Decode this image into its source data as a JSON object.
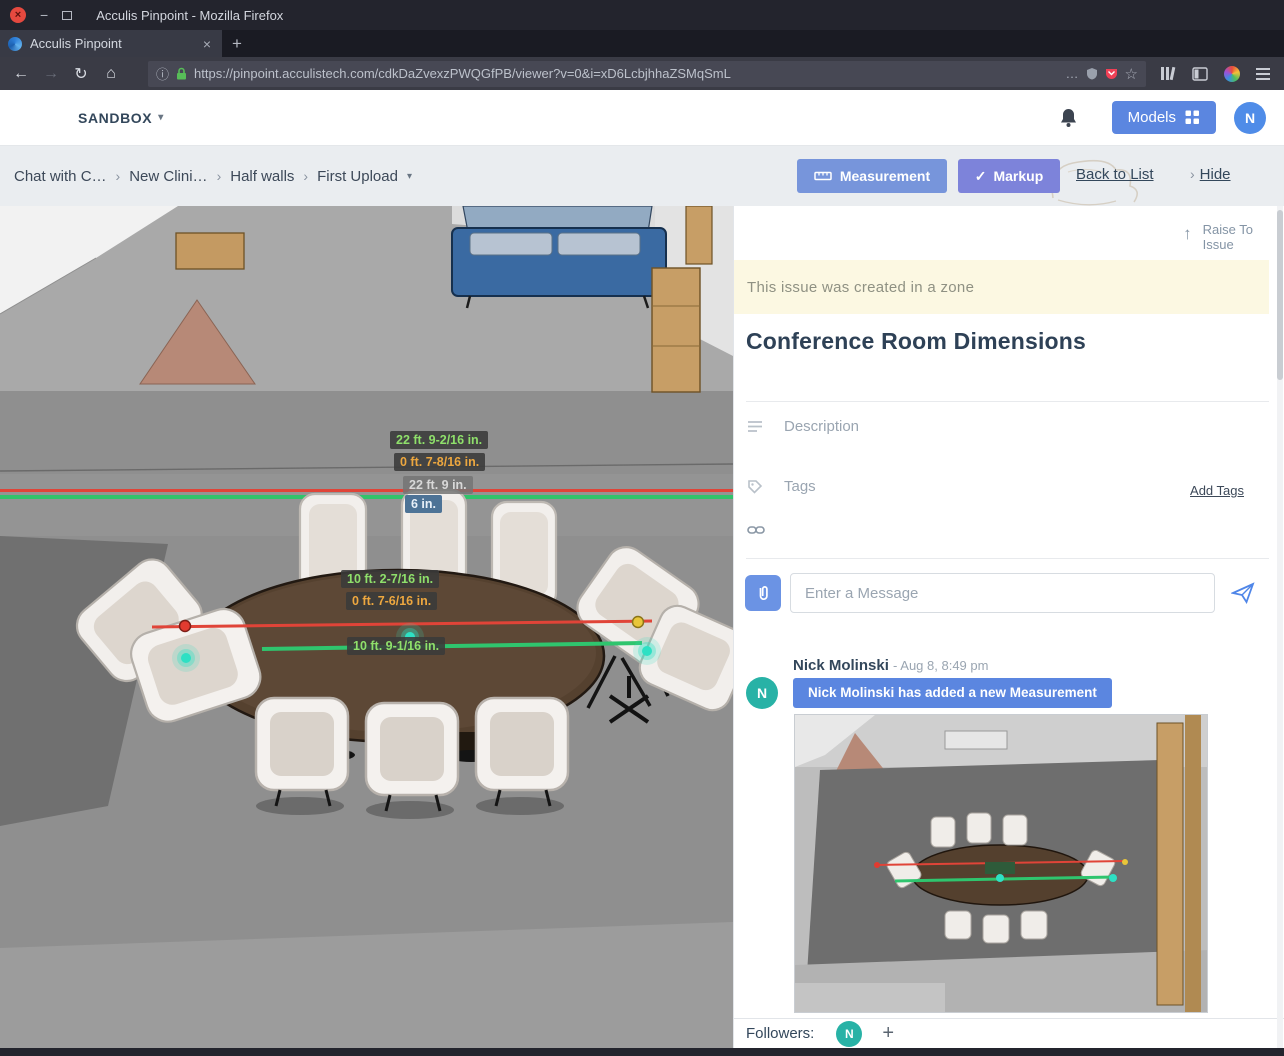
{
  "theme": {
    "accent_blue": "#5b86e0",
    "measurement_button_blue": "#7795db",
    "markup_button_purple": "#7d83da",
    "avatar_blue": "#4f8ce8",
    "avatar_teal": "#28b2a6",
    "banner_yellow": "#fcf8e2",
    "measure_green": "#8fe06b",
    "measure_orange": "#eda73f",
    "line_red": "#e04438",
    "line_green": "#2fc56e"
  },
  "icons": {
    "caret_down": "▾",
    "chevron": "›",
    "check": "✓",
    "up_arrow": "↑",
    "plus": "+",
    "home": "⌂",
    "reload": "↻",
    "back": "←",
    "forward": "→",
    "info": "ⓘ",
    "dots": "…",
    "star": "☆",
    "minimize": "−",
    "close": "×"
  },
  "browser": {
    "window_title": "Acculis Pinpoint - Mozilla Firefox",
    "tab_title": "Acculis Pinpoint",
    "tab_close": "×",
    "new_tab": "+",
    "url": "https://pinpoint.acculistech.com/cdkDaZvexzPWQGfPB/viewer?v=0&i=xD6LcbjhhaZSMqSmL"
  },
  "header": {
    "workspace": "SANDBOX",
    "models_label": "Models",
    "avatar_initial": "N"
  },
  "breadcrumbs": {
    "separator": "›",
    "items": [
      "Chat with C…",
      "New Clini…",
      "Half walls",
      "First Upload"
    ]
  },
  "toolbar": {
    "measurement": "Measurement",
    "markup": "Markup",
    "back_to_list": "Back to List",
    "hide": "Hide"
  },
  "viewer": {
    "measurements": [
      {
        "text": "22 ft. 9-2/16 in.",
        "style": "green"
      },
      {
        "text": "0 ft. 7-8/16 in.",
        "style": "orange"
      },
      {
        "text": "22 ft. 9 in.",
        "style": "gray"
      },
      {
        "text": "6 in.",
        "style": "selected"
      },
      {
        "text": "10 ft. 2-7/16 in.",
        "style": "green"
      },
      {
        "text": "0 ft. 7-6/16 in.",
        "style": "orange"
      },
      {
        "text": "10 ft. 9-1/16 in.",
        "style": "green"
      }
    ]
  },
  "panel": {
    "raise_line1": "Raise To",
    "raise_line2": "Issue",
    "zone_banner": "This issue was created in a zone",
    "title": "Conference Room Dimensions",
    "description_placeholder": "Description",
    "tags_placeholder": "Tags",
    "add_tags": "Add Tags",
    "message_placeholder": "Enter a Message",
    "comment": {
      "author": "Nick Molinski",
      "dash": "-",
      "time": "Aug 8, 8:49 pm",
      "badge": "Nick Molinski has added a new Measurement",
      "avatar_initial": "N"
    },
    "followers_label": "Followers:",
    "follower_initial": "N",
    "add_follower": "+"
  }
}
